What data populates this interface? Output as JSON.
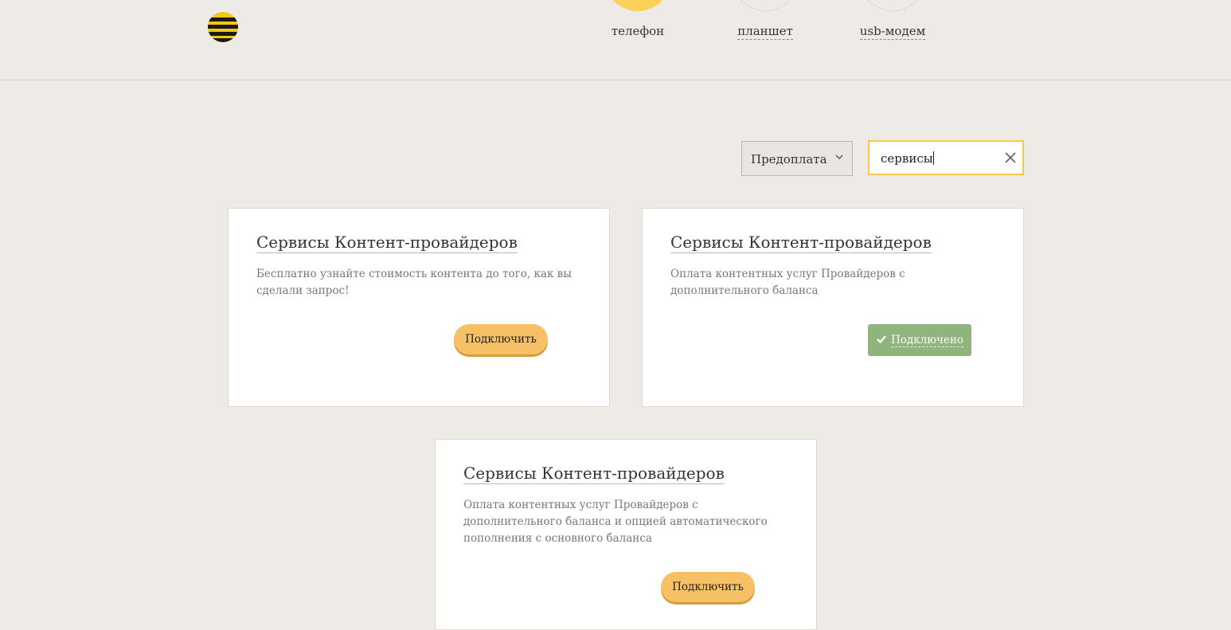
{
  "header": {
    "logo": "beeline-logo",
    "devices": [
      {
        "label": "телефон",
        "active": true
      },
      {
        "label": "планшет",
        "active": false
      },
      {
        "label": "usb-модем",
        "active": false
      }
    ]
  },
  "filters": {
    "payment_select": {
      "selected": "Предоплата"
    },
    "search": {
      "value": "сервисы",
      "clear_icon": "close-icon"
    }
  },
  "cards": [
    {
      "title": "Сервисы Контент-провайдеров",
      "description": "Бесплатно узнайте стоимость контента до того, как вы сделали запрос!",
      "button": "Подключить",
      "connected": false
    },
    {
      "title": "Сервисы Контент-провайдеров",
      "description": "Оплата контентных услуг Провайдеров с дополнительного баланса",
      "button": "Подключено",
      "connected": true
    },
    {
      "title": "Сервисы Контент-провайдеров",
      "description": "Оплата контентных услуг Провайдеров с дополнительного баланса и опцией автоматического пополнения с основного баланса",
      "button": "Подключить",
      "connected": false
    }
  ],
  "colors": {
    "background": "#eeebe6",
    "accent_yellow": "#f6c165",
    "connected_green": "#8fb47c",
    "search_border": "#f6c74f"
  }
}
